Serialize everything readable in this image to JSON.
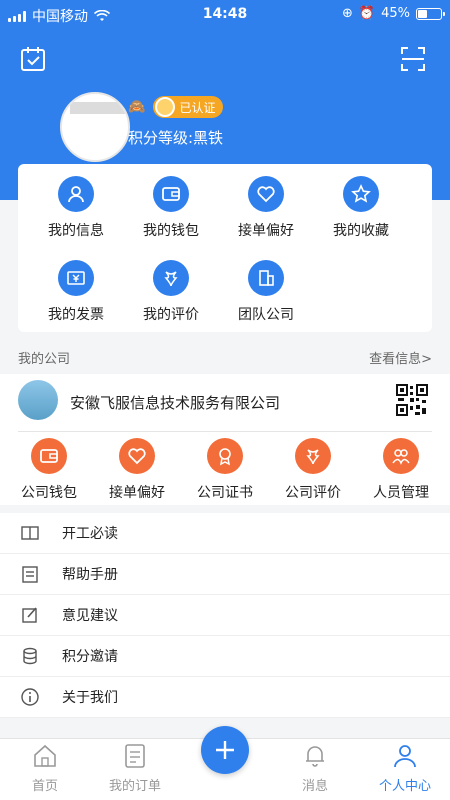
{
  "status_bar": {
    "carrier": "中国移动",
    "time": "14:48",
    "battery_percent": "45%",
    "battery_level": 0.45
  },
  "header": {
    "left_icon": "calendar-check-icon",
    "right_icon": "scan-icon",
    "verified_label": "已认证",
    "level_text": "积分等级:黑铁"
  },
  "quick_menu": [
    {
      "label": "我的信息",
      "icon": "user-icon"
    },
    {
      "label": "我的钱包",
      "icon": "wallet-icon"
    },
    {
      "label": "接单偏好",
      "icon": "heart-icon"
    },
    {
      "label": "我的收藏",
      "icon": "star-icon"
    },
    {
      "label": "我的发票",
      "icon": "invoice-icon"
    },
    {
      "label": "我的评价",
      "icon": "review-icon"
    },
    {
      "label": "团队公司",
      "icon": "building-icon"
    }
  ],
  "company": {
    "section_title": "我的公司",
    "view_info": "查看信息>",
    "name": "安徽飞服信息技术服务有限公司",
    "actions": [
      {
        "label": "公司钱包",
        "icon": "wallet-icon"
      },
      {
        "label": "接单偏好",
        "icon": "heart-icon"
      },
      {
        "label": "公司证书",
        "icon": "certificate-icon"
      },
      {
        "label": "公司评价",
        "icon": "review-icon"
      },
      {
        "label": "人员管理",
        "icon": "people-icon"
      }
    ]
  },
  "menu_list": [
    {
      "label": "开工必读",
      "icon": "book-icon"
    },
    {
      "label": "帮助手册",
      "icon": "manual-icon"
    },
    {
      "label": "意见建议",
      "icon": "edit-icon"
    },
    {
      "label": "积分邀请",
      "icon": "coins-icon"
    },
    {
      "label": "关于我们",
      "icon": "info-icon"
    }
  ],
  "tabbar": {
    "home": "首页",
    "orders": "我的订单",
    "messages": "消息",
    "profile": "个人中心"
  },
  "colors": {
    "primary": "#2f80ed",
    "accent_orange": "#f26d3a",
    "badge_orange": "#f5a623"
  }
}
